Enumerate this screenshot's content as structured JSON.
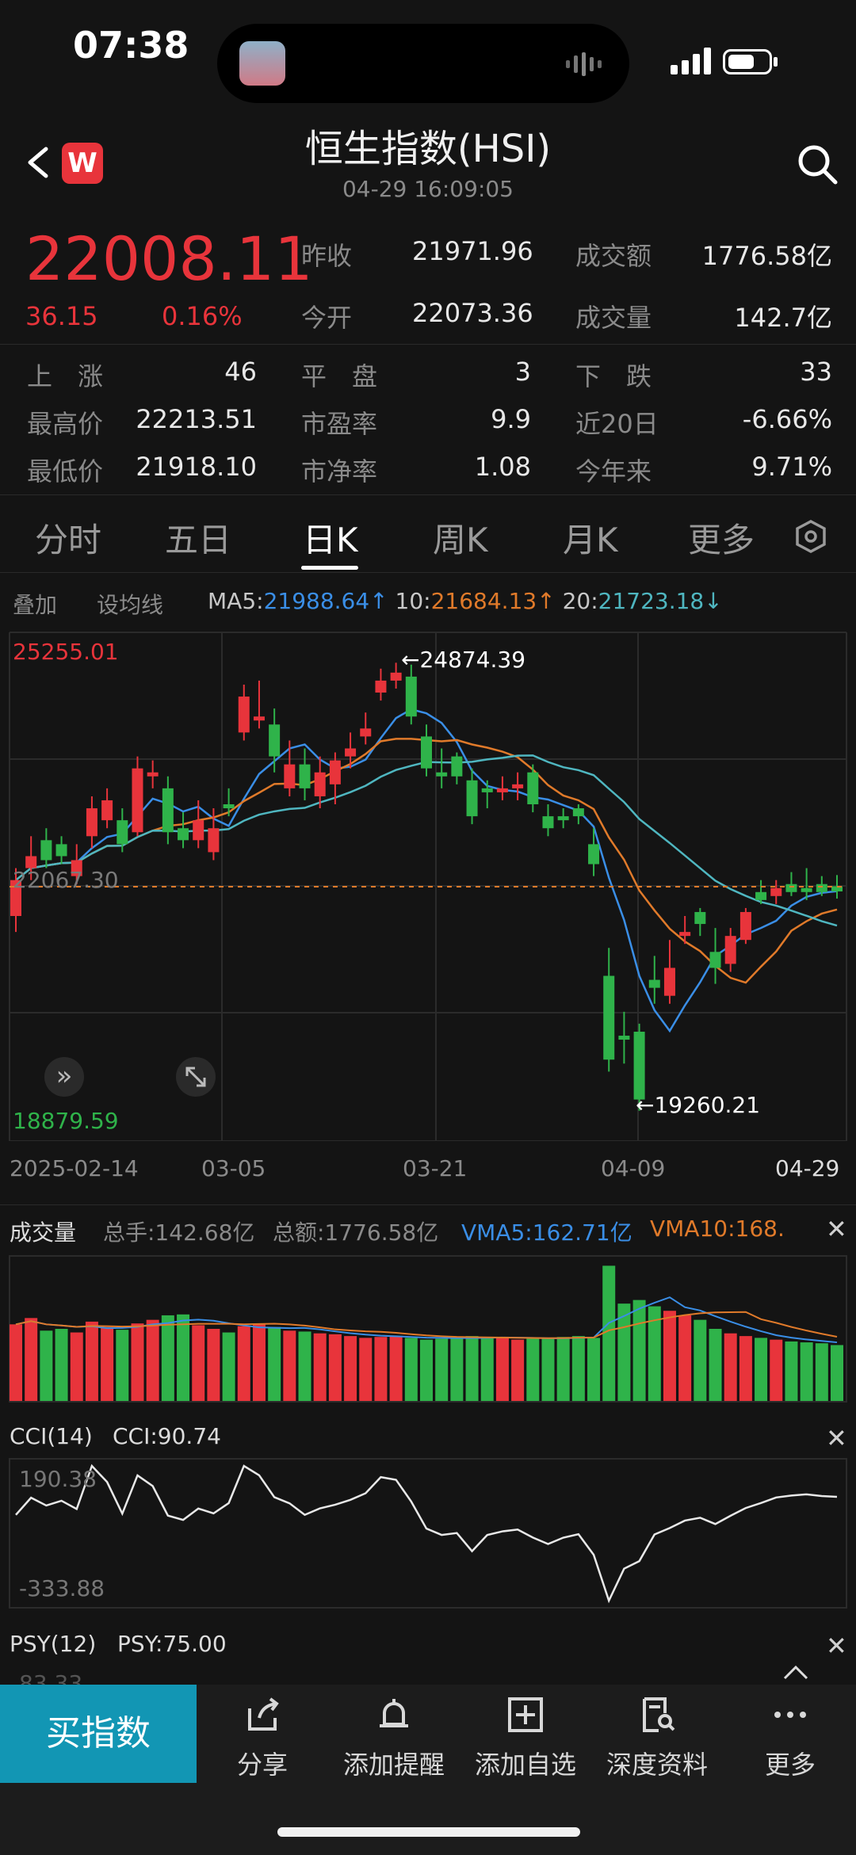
{
  "status": {
    "time": "07:38"
  },
  "header": {
    "title": "恒生指数(HSI)",
    "timestamp": "04-29 16:09:05",
    "brand_badge": "W"
  },
  "quote": {
    "price": "22008.11",
    "change": "36.15",
    "change_pct": "0.16%",
    "prev_close_label": "昨收",
    "prev_close": "21971.96",
    "open_label": "今开",
    "open": "22073.36",
    "turnover_label": "成交额",
    "turnover": "1776.58亿",
    "volume_label": "成交量",
    "volume": "142.7亿"
  },
  "stats": [
    {
      "label": "上　涨",
      "value": "46"
    },
    {
      "label": "平　盘",
      "value": "3"
    },
    {
      "label": "下　跌",
      "value": "33"
    },
    {
      "label": "最高价",
      "value": "22213.51"
    },
    {
      "label": "市盈率",
      "value": "9.9"
    },
    {
      "label": "近20日",
      "value": "-6.66%"
    },
    {
      "label": "最低价",
      "value": "21918.10"
    },
    {
      "label": "市净率",
      "value": "1.08"
    },
    {
      "label": "今年来",
      "value": "9.71%"
    }
  ],
  "tabs": [
    "分时",
    "五日",
    "日K",
    "周K",
    "月K",
    "更多"
  ],
  "active_tab": "日K",
  "ma_bar": {
    "overlay": "叠加",
    "set_ma": "设均线",
    "ma5_label": "MA5:",
    "ma5": "21988.64↑",
    "ma10_label": "10:",
    "ma10": "21684.13↑",
    "ma20_label": "20:",
    "ma20": "21723.18↓"
  },
  "kline": {
    "axis_max": "25255.01",
    "axis_min": "18879.59",
    "current_line": "22067.30",
    "high_marker": "←24874.39",
    "low_marker": "←19260.21",
    "dates": [
      "2025-02-14",
      "03-05",
      "03-21",
      "04-09",
      "04-29"
    ]
  },
  "volume_panel": {
    "title": "成交量",
    "total_hands": "总手:142.68亿",
    "total_amount": "总额:1776.58亿",
    "vma5": "VMA5:162.71亿",
    "vma10": "VMA10:168."
  },
  "cci_panel": {
    "title": "CCI(14)",
    "value": "CCI:90.74",
    "top": "190.38",
    "bottom": "-333.88"
  },
  "psy_panel": {
    "title": "PSY(12)",
    "value": "PSY:75.00",
    "top": "83.33"
  },
  "bottom_bar": {
    "buy": "买指数",
    "items": [
      "分享",
      "添加提醒",
      "添加自选",
      "深度资料",
      "更多"
    ]
  },
  "colors": {
    "up": "#e8343b",
    "down": "#2fb34a",
    "ma5": "#3a8ee6",
    "ma10": "#e07a2a",
    "ma20": "#4fb6c0",
    "buy_button": "#1296b4"
  },
  "chart_data": {
    "type": "candlestick",
    "y_range": [
      18879.59,
      25255.01
    ],
    "candles": [
      {
        "o": 21700,
        "c": 22150,
        "h": 22300,
        "l": 21500
      },
      {
        "o": 22300,
        "c": 22450,
        "h": 22700,
        "l": 22150
      },
      {
        "o": 22650,
        "c": 22400,
        "h": 22800,
        "l": 22300
      },
      {
        "o": 22600,
        "c": 22450,
        "h": 22700,
        "l": 22350
      },
      {
        "o": 22200,
        "c": 22400,
        "h": 22600,
        "l": 22100
      },
      {
        "o": 22700,
        "c": 23050,
        "h": 23200,
        "l": 22550
      },
      {
        "o": 22900,
        "c": 23150,
        "h": 23300,
        "l": 22800
      },
      {
        "o": 22900,
        "c": 22600,
        "h": 23050,
        "l": 22500
      },
      {
        "o": 22750,
        "c": 23550,
        "h": 23700,
        "l": 22700
      },
      {
        "o": 23450,
        "c": 23500,
        "h": 23650,
        "l": 23300
      },
      {
        "o": 23300,
        "c": 22750,
        "h": 23450,
        "l": 22600
      },
      {
        "o": 22800,
        "c": 22650,
        "h": 23000,
        "l": 22550
      },
      {
        "o": 22650,
        "c": 22900,
        "h": 23150,
        "l": 22550
      },
      {
        "o": 22500,
        "c": 22800,
        "h": 23050,
        "l": 22400
      },
      {
        "o": 23100,
        "c": 23050,
        "h": 23300,
        "l": 22950
      },
      {
        "o": 24000,
        "c": 24450,
        "h": 24600,
        "l": 23900
      },
      {
        "o": 24150,
        "c": 24200,
        "h": 24650,
        "l": 24050
      },
      {
        "o": 24100,
        "c": 23700,
        "h": 24300,
        "l": 23500
      },
      {
        "o": 23300,
        "c": 23600,
        "h": 23900,
        "l": 23200
      },
      {
        "o": 23600,
        "c": 23300,
        "h": 23800,
        "l": 23150
      },
      {
        "o": 23200,
        "c": 23500,
        "h": 23700,
        "l": 23050
      },
      {
        "o": 23350,
        "c": 23650,
        "h": 23750,
        "l": 23100
      },
      {
        "o": 23700,
        "c": 23800,
        "h": 24000,
        "l": 23550
      },
      {
        "o": 23950,
        "c": 24050,
        "h": 24250,
        "l": 23850
      },
      {
        "o": 24500,
        "c": 24650,
        "h": 24800,
        "l": 24400
      },
      {
        "o": 24650,
        "c": 24750,
        "h": 24874,
        "l": 24550
      },
      {
        "o": 24700,
        "c": 24200,
        "h": 24850,
        "l": 24100
      },
      {
        "o": 23950,
        "c": 23550,
        "h": 24100,
        "l": 23450
      },
      {
        "o": 23500,
        "c": 23450,
        "h": 23800,
        "l": 23300
      },
      {
        "o": 23700,
        "c": 23450,
        "h": 23750,
        "l": 23350
      },
      {
        "o": 23400,
        "c": 22950,
        "h": 23550,
        "l": 22850
      },
      {
        "o": 23300,
        "c": 23250,
        "h": 23400,
        "l": 23050
      },
      {
        "o": 23250,
        "c": 23300,
        "h": 23450,
        "l": 23150
      },
      {
        "o": 23300,
        "c": 23350,
        "h": 23500,
        "l": 23150
      },
      {
        "o": 23500,
        "c": 23100,
        "h": 23600,
        "l": 23000
      },
      {
        "o": 22950,
        "c": 22800,
        "h": 23100,
        "l": 22700
      },
      {
        "o": 22950,
        "c": 22900,
        "h": 23050,
        "l": 22800
      },
      {
        "o": 23050,
        "c": 22950,
        "h": 23100,
        "l": 22850
      },
      {
        "o": 22600,
        "c": 22350,
        "h": 22800,
        "l": 22200
      },
      {
        "o": 20950,
        "c": 19900,
        "h": 21300,
        "l": 19750
      },
      {
        "o": 20200,
        "c": 20150,
        "h": 20500,
        "l": 19850
      },
      {
        "o": 20250,
        "c": 19400,
        "h": 20350,
        "l": 19260
      },
      {
        "o": 20900,
        "c": 20800,
        "h": 21200,
        "l": 20600
      },
      {
        "o": 20700,
        "c": 21050,
        "h": 21400,
        "l": 20600
      },
      {
        "o": 21450,
        "c": 21500,
        "h": 21700,
        "l": 21350
      },
      {
        "o": 21750,
        "c": 21600,
        "h": 21800,
        "l": 21450
      },
      {
        "o": 21250,
        "c": 21050,
        "h": 21550,
        "l": 20850
      },
      {
        "o": 21100,
        "c": 21450,
        "h": 21550,
        "l": 21000
      },
      {
        "o": 21400,
        "c": 21750,
        "h": 21800,
        "l": 21350
      },
      {
        "o": 22000,
        "c": 21900,
        "h": 22150,
        "l": 21850
      },
      {
        "o": 21950,
        "c": 22050,
        "h": 22150,
        "l": 21850
      },
      {
        "o": 22100,
        "c": 22000,
        "h": 22250,
        "l": 21950
      },
      {
        "o": 22050,
        "c": 22000,
        "h": 22300,
        "l": 21900
      },
      {
        "o": 22100,
        "c": 22000,
        "h": 22200,
        "l": 21950
      },
      {
        "o": 22073,
        "c": 22008,
        "h": 22213,
        "l": 21918
      }
    ],
    "volume": [
      85,
      92,
      78,
      80,
      76,
      88,
      82,
      79,
      86,
      90,
      95,
      96,
      84,
      80,
      76,
      83,
      85,
      82,
      78,
      77,
      75,
      74,
      72,
      70,
      71,
      72,
      70,
      68,
      69,
      70,
      72,
      71,
      70,
      68,
      69,
      70,
      71,
      72,
      70,
      150,
      108,
      112,
      105,
      100,
      95,
      90,
      80,
      75,
      72,
      70,
      68,
      66,
      65,
      64,
      62
    ]
  }
}
